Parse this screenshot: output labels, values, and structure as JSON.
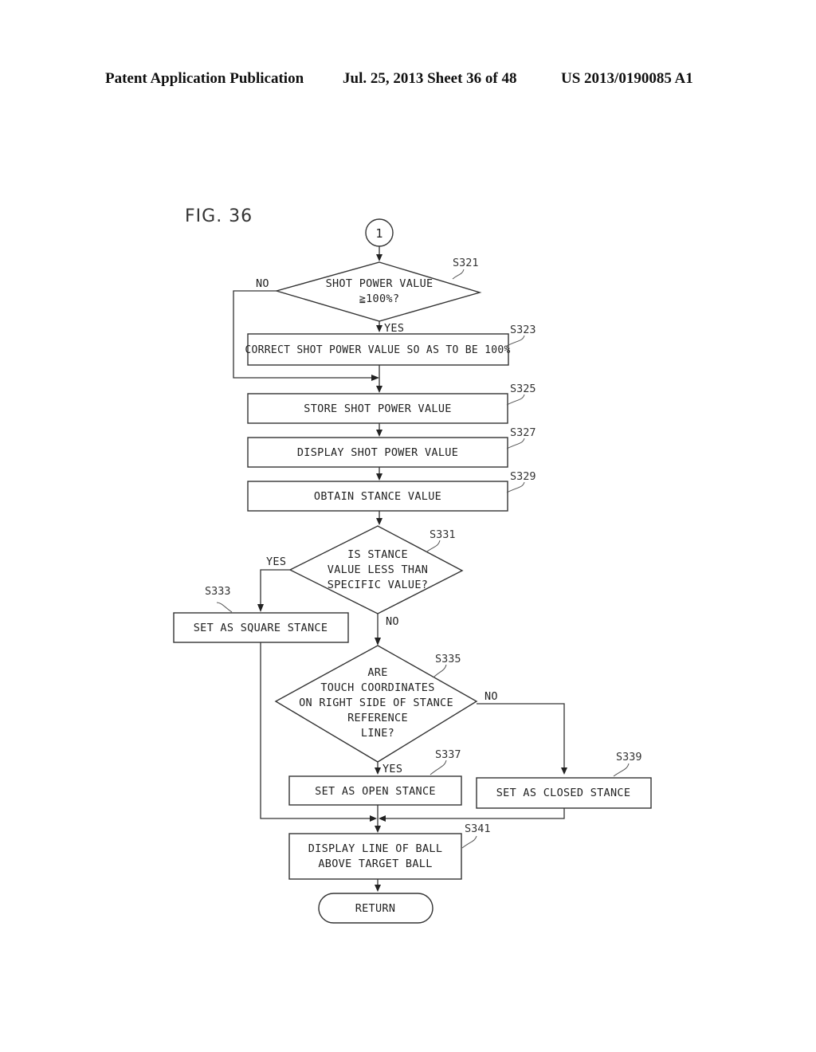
{
  "header": {
    "publication": "Patent Application Publication",
    "date_sheet": "Jul. 25, 2013   Sheet 36 of 48",
    "number": "US 2013/0190085 A1"
  },
  "figure": {
    "label": "FIG. 36",
    "connector": "1",
    "steps": {
      "s321": {
        "ref": "S321",
        "type": "decision",
        "lines": [
          "SHOT POWER VALUE",
          "≧100%?"
        ],
        "yes": "YES",
        "no": "NO"
      },
      "s323": {
        "ref": "S323",
        "type": "process",
        "lines": [
          "CORRECT SHOT POWER VALUE SO AS TO BE 100%"
        ]
      },
      "s325": {
        "ref": "S325",
        "type": "process",
        "lines": [
          "STORE SHOT POWER VALUE"
        ]
      },
      "s327": {
        "ref": "S327",
        "type": "process",
        "lines": [
          "DISPLAY SHOT POWER VALUE"
        ]
      },
      "s329": {
        "ref": "S329",
        "type": "process",
        "lines": [
          "OBTAIN STANCE VALUE"
        ]
      },
      "s331": {
        "ref": "S331",
        "type": "decision",
        "lines": [
          "IS STANCE",
          "VALUE LESS THAN",
          "SPECIFIC VALUE?"
        ],
        "yes": "YES",
        "no": "NO"
      },
      "s333": {
        "ref": "S333",
        "type": "process",
        "lines": [
          "SET AS SQUARE STANCE"
        ]
      },
      "s335": {
        "ref": "S335",
        "type": "decision",
        "lines": [
          "ARE",
          "TOUCH COORDINATES",
          "ON RIGHT SIDE OF STANCE",
          "REFERENCE",
          "LINE?"
        ],
        "yes": "YES",
        "no": "NO"
      },
      "s337": {
        "ref": "S337",
        "type": "process",
        "lines": [
          "SET AS OPEN STANCE"
        ]
      },
      "s339": {
        "ref": "S339",
        "type": "process",
        "lines": [
          "SET AS CLOSED STANCE"
        ]
      },
      "s341": {
        "ref": "S341",
        "type": "process",
        "lines": [
          "DISPLAY LINE OF BALL",
          "ABOVE TARGET BALL"
        ]
      }
    },
    "terminal": "RETURN"
  }
}
